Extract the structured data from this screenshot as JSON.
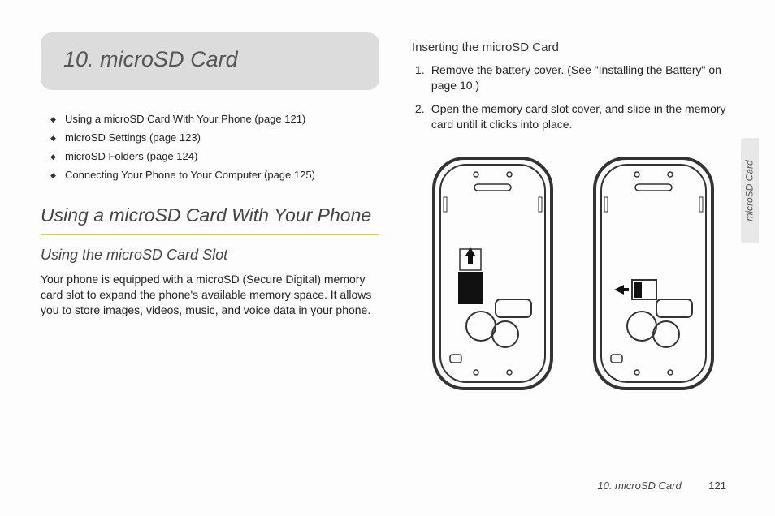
{
  "chapter": {
    "number": "10.",
    "title": "microSD Card"
  },
  "toc": [
    "Using a microSD Card With Your Phone (page 121)",
    "microSD Settings (page 123)",
    "microSD Folders (page 124)",
    "Connecting Your Phone to Your Computer (page 125)"
  ],
  "section": {
    "heading": "Using a microSD Card With Your Phone",
    "subheading": "Using the microSD Card Slot",
    "body": "Your phone is equipped with a microSD (Secure Digital) memory card slot to expand the phone's available memory space. It allows you to store images, videos, music, and voice data in your phone."
  },
  "right": {
    "subsection": "Inserting the microSD Card",
    "steps": [
      "Remove the battery cover. (See \"Installing the Battery\" on page 10.)",
      "Open the memory card slot cover, and slide in the memory card until it clicks into place."
    ]
  },
  "sideTab": "microSD Card",
  "footer": {
    "chapter": "10. microSD Card",
    "page": "121"
  }
}
